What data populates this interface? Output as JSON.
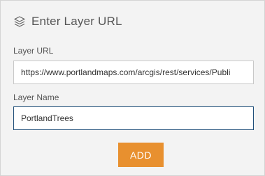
{
  "dialog": {
    "title": "Enter Layer URL",
    "icon": "layers-icon"
  },
  "layer_url": {
    "label": "Layer URL",
    "value": "https://www.portlandmaps.com/arcgis/rest/services/Publi"
  },
  "layer_name": {
    "label": "Layer Name",
    "value": "PortlandTrees"
  },
  "add_button": {
    "label": "ADD",
    "color": "#e8902f"
  }
}
